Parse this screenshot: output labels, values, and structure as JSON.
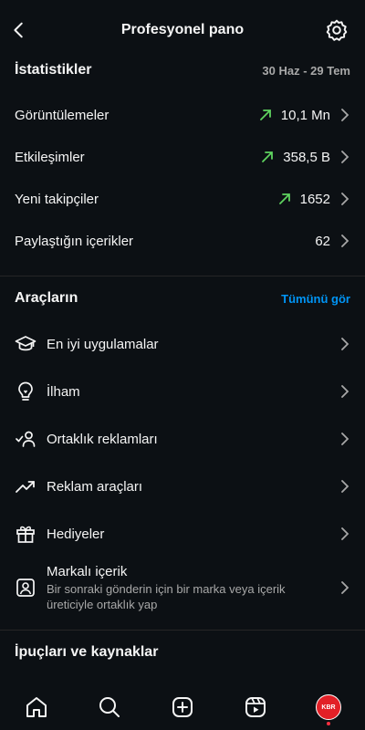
{
  "header": {
    "title": "Profesyonel pano"
  },
  "stats": {
    "title": "İstatistikler",
    "range": "30 Haz - 29 Tem",
    "rows": [
      {
        "label": "Görüntülemeler",
        "value": "10,1 Mn",
        "trend": "up"
      },
      {
        "label": "Etkileşimler",
        "value": "358,5 B",
        "trend": "up"
      },
      {
        "label": "Yeni takipçiler",
        "value": "1652",
        "trend": "up"
      },
      {
        "label": "Paylaştığın içerikler",
        "value": "62",
        "trend": "none"
      }
    ]
  },
  "tools": {
    "title": "Araçların",
    "see_all": "Tümünü gör",
    "items": [
      {
        "label": "En iyi uygulamalar",
        "icon": "graduation-cap-icon"
      },
      {
        "label": "İlham",
        "icon": "lightbulb-icon"
      },
      {
        "label": "Ortaklık reklamları",
        "icon": "partnership-icon"
      },
      {
        "label": "Reklam araçları",
        "icon": "trend-chart-icon"
      },
      {
        "label": "Hediyeler",
        "icon": "gift-icon"
      },
      {
        "label": "Markalı içerik",
        "sub": "Bir sonraki gönderin için bir marka veya içerik üreticiyle ortaklık yap",
        "icon": "branded-content-icon"
      }
    ]
  },
  "tips": {
    "title": "İpuçları ve kaynaklar"
  },
  "nav": {
    "items": [
      "home-icon",
      "search-icon",
      "create-icon",
      "reels-icon",
      "profile-avatar"
    ],
    "avatar_text": "KBR"
  },
  "colors": {
    "accent": "#0095f6",
    "trend_up": "#5fd35f",
    "background": "#0c1014",
    "notification": "#ff3040"
  }
}
